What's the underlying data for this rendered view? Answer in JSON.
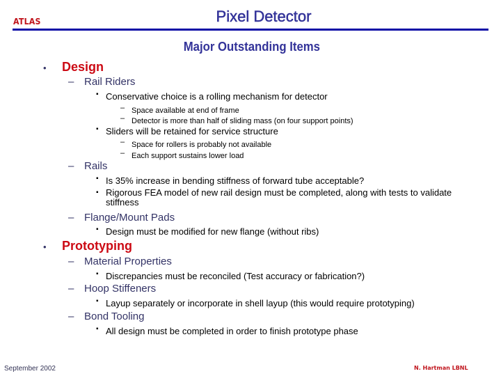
{
  "header": {
    "logo_text": "ATLAS",
    "title": "Pixel Detector",
    "subtitle": "Major Outstanding Items"
  },
  "colors": {
    "title_blue": "#333399",
    "rule_blue": "#0a0aa6",
    "accent_red": "#cc0a14",
    "level2_text": "#333366"
  },
  "outline": {
    "design": {
      "bullet": "•",
      "label": "Design",
      "rail_riders": {
        "dash": "–",
        "label": "Rail Riders",
        "items": [
          {
            "bullet": "▪",
            "text": "Conservative choice is a rolling mechanism for detector",
            "sub": [
              {
                "dash": "–",
                "text": "Space available at end of frame"
              },
              {
                "dash": "–",
                "text": "Detector is more than half of sliding mass (on four support points)"
              }
            ]
          },
          {
            "bullet": "▪",
            "text": "Sliders will be retained for service structure",
            "sub": [
              {
                "dash": "–",
                "text": "Space for rollers is probably not available"
              },
              {
                "dash": "–",
                "text": "Each support sustains lower load"
              }
            ]
          }
        ]
      },
      "rails": {
        "dash": "–",
        "label": "Rails",
        "items": [
          {
            "bullet": "▪",
            "text": "Is 35% increase in bending stiffness of forward tube acceptable?"
          },
          {
            "bullet": "▪",
            "text": "Rigorous FEA model of new rail design must be completed, along with tests to validate stiffness"
          }
        ]
      },
      "flange": {
        "dash": "–",
        "label": "Flange/Mount Pads",
        "items": [
          {
            "bullet": "▪",
            "text": "Design must be modified for new flange (without ribs)"
          }
        ]
      }
    },
    "prototyping": {
      "bullet": "•",
      "label": "Prototyping",
      "material": {
        "dash": "–",
        "label": "Material Properties",
        "items": [
          {
            "bullet": "▪",
            "text": "Discrepancies must be reconciled (Test accuracy or fabrication?)"
          }
        ]
      },
      "hoop": {
        "dash": "–",
        "label": "Hoop Stiffeners",
        "items": [
          {
            "bullet": "▪",
            "text": "Layup separately or incorporate in shell layup (this would require prototyping)"
          }
        ]
      },
      "bond": {
        "dash": "–",
        "label": "Bond Tooling",
        "items": [
          {
            "bullet": "▪",
            "text": "All design must be completed in order to finish prototype phase"
          }
        ]
      }
    }
  },
  "footer": {
    "date": "September 2002",
    "author": "N. Hartman LBNL"
  }
}
